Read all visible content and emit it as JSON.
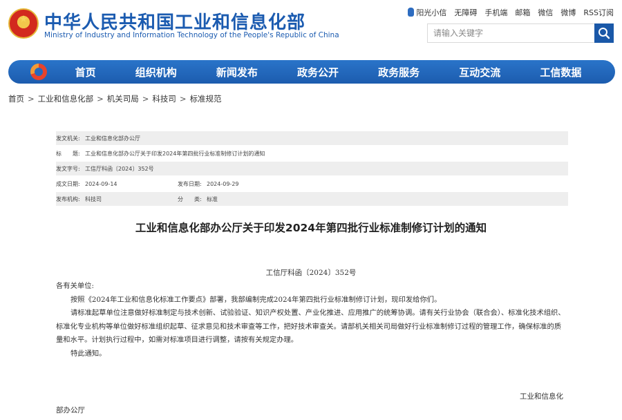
{
  "header": {
    "site_title": "中华人民共和国工业和信息化部",
    "site_subtitle": "Ministry of Industry and Information Technology of the People's Republic of China",
    "top_links": [
      "阳光小信",
      "无障碍",
      "手机端",
      "邮箱",
      "微信",
      "微博",
      "RSS订阅"
    ],
    "search_placeholder": "请输入关键字"
  },
  "nav": {
    "items": [
      "首页",
      "组织机构",
      "新闻发布",
      "政务公开",
      "政务服务",
      "互动交流",
      "工信数据"
    ]
  },
  "breadcrumb": {
    "items": [
      "首页",
      "工业和信息化部",
      "机关司局",
      "科技司",
      "标准规范"
    ],
    "separator": ">"
  },
  "meta": {
    "issuer_label": "发文机关:",
    "issuer": "工业和信息化部办公厅",
    "title_label": "标　　题:",
    "title": "工业和信息化部办公厅关于印发2024年第四批行业标准制修订计划的通知",
    "doc_no_label": "发文字号:",
    "doc_no": "工信厅科函〔2024〕352号",
    "created_label": "成文日期:",
    "created": "2024-09-14",
    "published_label": "发布日期:",
    "published": "2024-09-29",
    "agency_label": "发布机构:",
    "agency": "科技司",
    "category_label": "分　　类:",
    "category": "标准"
  },
  "article": {
    "title": "工业和信息化部办公厅关于印发2024年第四批行业标准制修订计划的通知",
    "doc_number": "工信厅科函〔2024〕352号",
    "salutation": "各有关单位:",
    "paragraph1": "按照《2024年工业和信息化标准工作要点》部署，我部编制完成2024年第四批行业标准制修订计划，现印发给你们。",
    "paragraph2": "请标准起草单位注意做好标准制定与技术创新、试验验证、知识产权处置、产业化推进、应用推广的统筹协调。请有关行业协会（联合会）、标准化技术组织、标准化专业机构等单位做好标准组织起草、征求意见和技术审查等工作，把好技术审查关。请部机关相关司局做好行业标准制修订过程的管理工作，确保标准的质量和水平。计划执行过程中，如需对标准项目进行调整，请按有关规定办理。",
    "closing": "特此通知。",
    "signature_line1": "工业和信息化",
    "signature_line2": "部办公厅"
  },
  "colors": {
    "brand_blue": "#1b5bb0",
    "nav_blue": "#1c5cae",
    "meta_shade": "#eeeeee"
  }
}
